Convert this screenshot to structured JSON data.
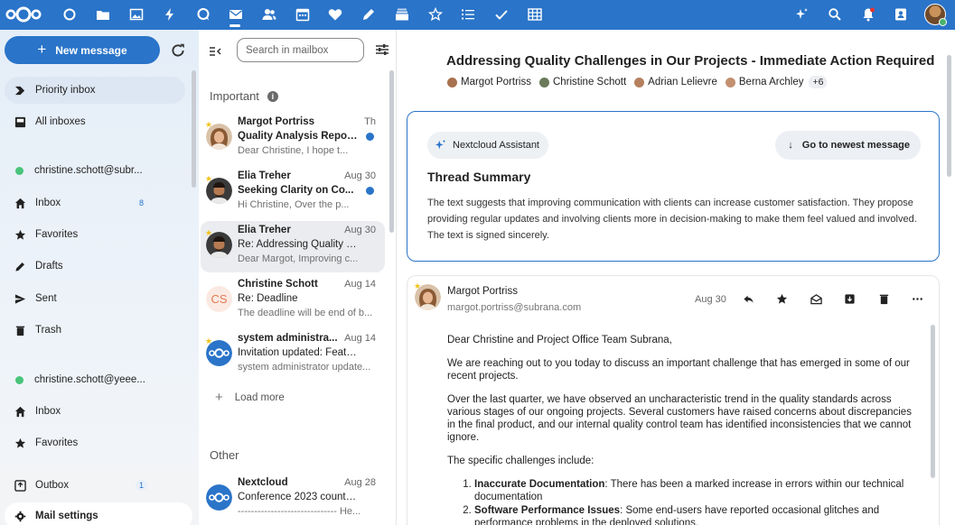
{
  "topbar": {
    "apps": [
      "dashboard-icon",
      "files-icon",
      "photos-icon",
      "activity-icon",
      "talk-icon",
      "mail-icon",
      "contacts-icon",
      "calendar-icon",
      "favorites-icon",
      "notes-icon",
      "deck-icon",
      "assistant-app-icon",
      "tasks-icon",
      "checklist-icon",
      "tables-icon"
    ],
    "right_icons": [
      "assistant-icon",
      "search-icon",
      "notifications-icon",
      "contacts-menu-icon"
    ]
  },
  "nav": {
    "new_message": "New message",
    "items": [
      {
        "label": "Priority inbox",
        "icon": "priority-icon",
        "active": true
      },
      {
        "label": "All inboxes",
        "icon": "all-inboxes-icon"
      }
    ],
    "account1": {
      "email": "christine.schott@subr...",
      "items": [
        {
          "label": "Inbox",
          "icon": "home-icon",
          "count": "8"
        },
        {
          "label": "Favorites",
          "icon": "star-icon"
        },
        {
          "label": "Drafts",
          "icon": "pencil-icon"
        },
        {
          "label": "Sent",
          "icon": "send-icon"
        },
        {
          "label": "Trash",
          "icon": "trash-icon"
        }
      ]
    },
    "account2": {
      "email": "christine.schott@yeee...",
      "items": [
        {
          "label": "Inbox",
          "icon": "home-icon"
        },
        {
          "label": "Favorites",
          "icon": "star-icon"
        }
      ]
    },
    "outbox": {
      "label": "Outbox",
      "count": "1"
    },
    "settings": "Mail settings"
  },
  "list": {
    "search_placeholder": "Search in mailbox",
    "important_label": "Important",
    "other_label": "Other",
    "load_more": "Load more",
    "messages": [
      {
        "from": "Margot Portriss",
        "date": "Th",
        "subject": "Quality Analysis Repor...",
        "preview": "Dear Christine,    I hope t...",
        "unread": true,
        "avatar": "photo-woman"
      },
      {
        "from": "Elia Treher",
        "date": "Aug 30",
        "subject": "Seeking Clarity on Co...",
        "preview": "Hi Christine,    Over the p...",
        "unread": true,
        "avatar": "photo-man"
      },
      {
        "from": "Elia Treher",
        "date": "Aug 30",
        "subject": "Re: Addressing Quality Ch...",
        "preview": "Dear Margot,    Improving c...",
        "unread": false,
        "avatar": "photo-man"
      },
      {
        "from": "Christine Schott",
        "date": "Aug 14",
        "subject": "Re: Deadline",
        "preview": "The deadline will be end of b...",
        "unread": false,
        "avatar": "initials",
        "initials": "CS"
      },
      {
        "from": "system administra...",
        "date": "Aug 14",
        "subject": "Invitation updated: Feature d...",
        "preview": "system administrator update...",
        "unread": false,
        "avatar": "nextcloud"
      }
    ],
    "other_messages": [
      {
        "from": "Nextcloud",
        "date": "Aug 28",
        "subject": "Conference 2023 countdown...",
        "preview": "------------------------------    He...",
        "avatar": "nextcloud"
      }
    ]
  },
  "thread": {
    "title": "Addressing Quality Challenges in Our Projects - Immediate Action Required",
    "participants": [
      "Margot Portriss",
      "Christine Schott",
      "Adrian Lelievre",
      "Berna Archley"
    ],
    "more_count": "+6",
    "assistant_label": "Nextcloud Assistant",
    "newest_button": "Go to newest message",
    "summary_title": "Thread Summary",
    "summary_text": "The text suggests that improving communication with clients can increase customer satisfaction. They propose providing regular updates and involving clients more in decision-making to make them feel valued and involved. The text is signed sincerely.",
    "message": {
      "sender": "Margot Portriss",
      "email": "margot.portriss@subrana.com",
      "date": "Aug 30",
      "greeting": "Dear Christine and Project Office Team Subrana,",
      "para1": "We are reaching out to you today to discuss an important challenge that has emerged in some of our recent projects.",
      "para2": "Over the last quarter, we have observed an uncharacteristic trend in the quality standards across various stages of our ongoing projects. Several customers have raised concerns about discrepancies in the final product, and our internal quality control team has identified inconsistencies that we cannot ignore.",
      "para3": "The specific challenges include:",
      "li1_bold": "Inaccurate Documentation",
      "li1_text": ": There has been a marked increase in errors within our technical documentation",
      "li2_bold": "Software Performance Issues",
      "li2_text": ": Some end-users have reported occasional glitches and performance problems in the deployed solutions."
    }
  },
  "colors": {
    "primary": "#2a74c9",
    "online": "#49c47a",
    "star": "#f2c21b"
  }
}
